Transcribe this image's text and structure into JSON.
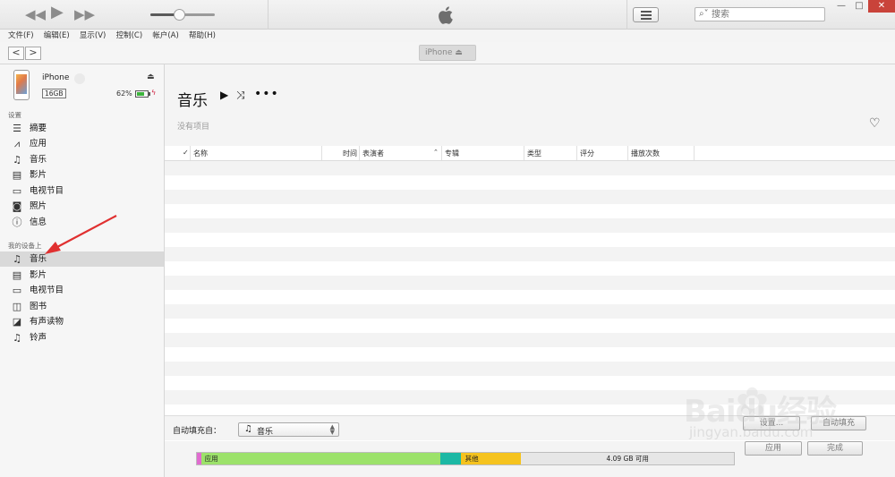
{
  "player": {
    "prev_icon": "rewind-icon",
    "play_icon": "play-icon",
    "next_icon": "fast-forward-icon",
    "volume_level": 0.45
  },
  "search": {
    "placeholder": "搜索"
  },
  "window_controls": {
    "minimize": "—",
    "maximize": "□",
    "close": "✕"
  },
  "menu": [
    "文件(F)",
    "编辑(E)",
    "显示(V)",
    "控制(C)",
    "帐户(A)",
    "帮助(H)"
  ],
  "nav": {
    "back": "<",
    "forward": ">",
    "device_tab": "iPhone"
  },
  "device": {
    "name": "iPhone",
    "capacity": "16GB",
    "battery_pct": "62%",
    "battery_level": 0.62
  },
  "sidebar": {
    "settings_title": "设置",
    "settings_items": [
      {
        "label": "摘要",
        "icon": "summary-icon"
      },
      {
        "label": "应用",
        "icon": "apps-icon"
      },
      {
        "label": "音乐",
        "icon": "music-icon"
      },
      {
        "label": "影片",
        "icon": "film-icon"
      },
      {
        "label": "电视节目",
        "icon": "tv-icon"
      },
      {
        "label": "照片",
        "icon": "camera-icon"
      },
      {
        "label": "信息",
        "icon": "info-icon"
      }
    ],
    "ondevice_title": "我的设备上",
    "ondevice_items": [
      {
        "label": "音乐",
        "icon": "music-icon"
      },
      {
        "label": "影片",
        "icon": "film-icon"
      },
      {
        "label": "电视节目",
        "icon": "tv-icon"
      },
      {
        "label": "图书",
        "icon": "book-icon"
      },
      {
        "label": "有声读物",
        "icon": "audiobook-icon"
      },
      {
        "label": "铃声",
        "icon": "bell-icon"
      }
    ]
  },
  "main": {
    "title": "音乐",
    "empty": "没有项目",
    "columns": {
      "check": "✓",
      "name": "名称",
      "time": "时间",
      "artist": "表演者",
      "album": "专辑",
      "genre": "类型",
      "rating": "评分",
      "plays": "播放次数"
    }
  },
  "autofill": {
    "label": "自动填充自：",
    "source": "音乐",
    "settings_button": "设置...",
    "fill_button": "自动填充"
  },
  "capacity": {
    "segments": [
      {
        "label": "",
        "color": "#e06bd0",
        "fraction": 0.006
      },
      {
        "label": "应用",
        "color": "#9ce26a",
        "fraction": 0.448
      },
      {
        "label": "",
        "color": "#1cb8a4",
        "fraction": 0.037
      },
      {
        "label": "其他",
        "color": "#f5c31e",
        "fraction": 0.113
      }
    ],
    "free_label": "4.09 GB 可用"
  },
  "actions": {
    "apply": "应用",
    "done": "完成"
  },
  "watermark": {
    "brand": "Baidu经验",
    "url": "jingyan.baidu.com"
  },
  "colors": {
    "accent_red": "#e03030",
    "selected_row": "#d9d9d9"
  }
}
